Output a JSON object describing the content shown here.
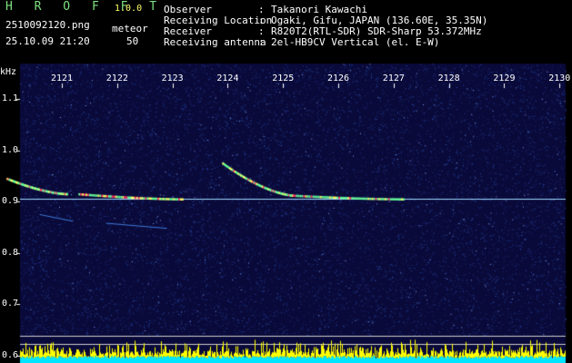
{
  "app": {
    "name": "H R O F F T",
    "version": "1.0.0"
  },
  "file": {
    "name": "2510092120.png",
    "datetime": "25.10.09 21:20"
  },
  "detection": {
    "mode": "meteor",
    "count": "50"
  },
  "station": {
    "observer_label": "Observer",
    "observer": "Takanori Kawachi",
    "location_label": "Receiving Location",
    "location": "Ogaki, Gifu, JAPAN (136.60E, 35.35N)",
    "receiver_label": "Receiver",
    "receiver": "R820T2(RTL-SDR) SDR-Sharp 53.372MHz",
    "antenna_label": "Receiving antenna",
    "antenna": "2el-HB9CV Vertical (el. E-W)",
    "colon": ":"
  },
  "chart_data": {
    "type": "heatmap",
    "ylabel": "kHz",
    "y_ticks": [
      "1.1",
      "1.0",
      "0.9",
      "0.8",
      "0.7",
      "0.6"
    ],
    "y_tick_values": [
      1.1,
      1.0,
      0.9,
      0.8,
      0.7,
      0.6
    ],
    "x_ticks": [
      "2121",
      "2122",
      "2123",
      "2124",
      "2125",
      "2126",
      "2127",
      "2128",
      "2129",
      "2130"
    ],
    "ylim": [
      0.585,
      1.17
    ],
    "carrier_khz": 0.905,
    "echoes": [
      {
        "start_min": 2120.0,
        "end_min": 2121.1,
        "start_khz": 0.945,
        "end_khz": 0.915
      },
      {
        "start_min": 2121.3,
        "end_min": 2123.2,
        "start_khz": 0.915,
        "end_khz": 0.905
      },
      {
        "start_min": 2123.9,
        "end_min": 2125.2,
        "start_khz": 0.975,
        "end_khz": 0.912
      },
      {
        "start_min": 2125.2,
        "end_min": 2127.2,
        "start_khz": 0.912,
        "end_khz": 0.905
      }
    ],
    "colors": {
      "background": "#0a0a3a",
      "noise": "#2a4fb0",
      "carrier": "#9fd8ff",
      "echo_hot": "#ff3366",
      "echo_warm": "#ffff66",
      "echo_cool": "#66ff99",
      "activity_bar": "#ffff00",
      "activity_base": "#00e5ff"
    }
  }
}
